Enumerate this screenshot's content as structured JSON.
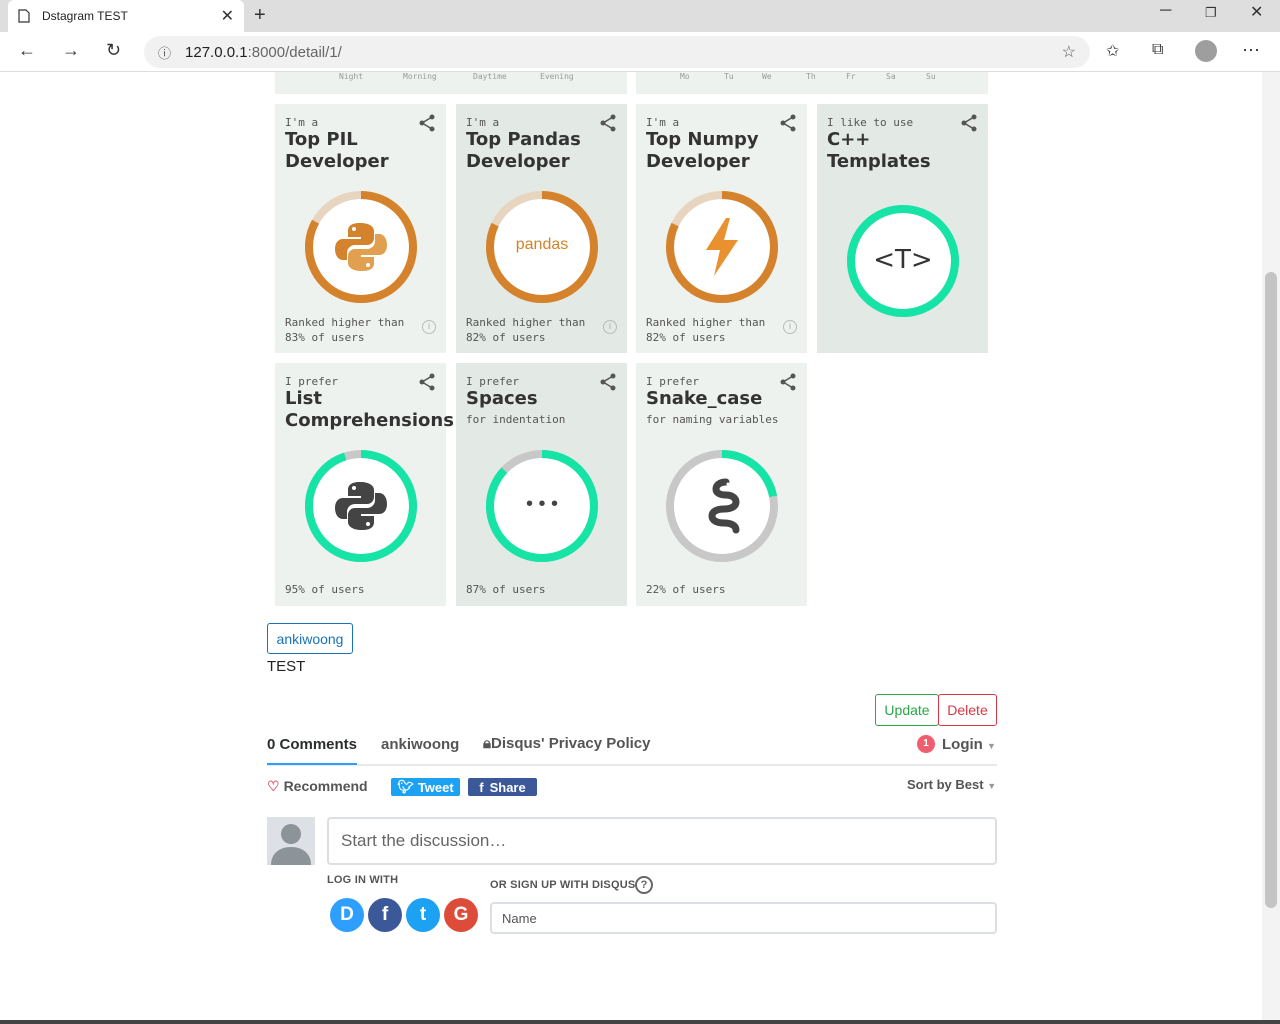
{
  "browser": {
    "tab_title": "Dstagram TEST",
    "url_host": "127.0.0.1",
    "url_rest": ":8000/detail/1/"
  },
  "strip_left_labels": [
    "Night",
    "Morning",
    "Daytime",
    "Evening"
  ],
  "strip_right_labels": [
    "Mo",
    "Tu",
    "We",
    "Th",
    "Fr",
    "Sa",
    "Su"
  ],
  "cards_row1": [
    {
      "sup": "I'm a",
      "heading": "Top PIL Developer",
      "foot1": "Ranked higher than",
      "foot2": "83% of users",
      "icon": "python-logo-icon",
      "progress": 0.83
    },
    {
      "sup": "I'm a",
      "heading": "Top Pandas Developer",
      "foot1": "Ranked higher than",
      "foot2": "82% of users",
      "icon": "pandas-logo",
      "logo_text": "pandas",
      "progress": 0.82
    },
    {
      "sup": "I'm a",
      "heading": "Top Numpy Developer",
      "foot1": "Ranked higher than",
      "foot2": "82% of users",
      "icon": "lightning-icon",
      "progress": 0.82
    },
    {
      "sup": "I like to use",
      "heading": "C++ Templates",
      "icon": "template-icon",
      "logo_text": "<T>",
      "progress": 1.0
    }
  ],
  "cards_row2": [
    {
      "sup": "I prefer",
      "heading": "List Comprehensions",
      "foot": "95% of users",
      "icon": "python-logo-icon",
      "progress": 0.95
    },
    {
      "sup": "I prefer",
      "heading": "Spaces",
      "sub": "for indentation",
      "foot": "87% of users",
      "icon": "dots-icon",
      "logo_text": "• • •",
      "progress": 0.87
    },
    {
      "sup": "I prefer",
      "heading": "Snake_case",
      "sub": "for naming variables",
      "foot": "22% of users",
      "icon": "snake-icon",
      "progress": 0.22
    }
  ],
  "post": {
    "author_tag": "ankiwoong",
    "text": "TEST",
    "update_label": "Update",
    "delete_label": "Delete"
  },
  "disqus": {
    "comments_tab": "0 Comments",
    "site_tab": "ankiwoong",
    "privacy_tab": "Disqus' Privacy Policy",
    "notif_count": "1",
    "login_label": "Login",
    "recommend_label": "Recommend",
    "tweet_label": "Tweet",
    "share_label": "Share",
    "sort_label": "Sort by Best",
    "input_placeholder": "Start the discussion…",
    "login_with": "LOG IN WITH",
    "signup_with": "OR SIGN UP WITH DISQUS",
    "name_placeholder": "Name",
    "social": [
      "D",
      "f",
      "t",
      "G"
    ]
  },
  "colors": {
    "accent_orange": "#d4822c",
    "accent_green": "#15e4a6",
    "card_bg": "#eef2ee",
    "card_bg_alt": "#e3e9e4"
  }
}
